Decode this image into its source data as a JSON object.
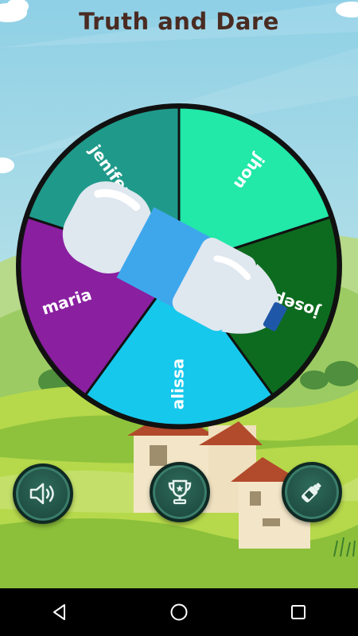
{
  "app": {
    "title": "Truth and Dare"
  },
  "wheel": {
    "players": [
      "jhon",
      "joseph",
      "alissa",
      "maria",
      "jenifer"
    ],
    "colors": [
      "#22e8a8",
      "#0d6b1f",
      "#16c8ec",
      "#8a1fa0",
      "#1f9a8a"
    ]
  },
  "buttons": {
    "sound": {
      "icon": "speaker-icon"
    },
    "leaderboard": {
      "icon": "trophy-icon"
    },
    "bottle": {
      "icon": "bottle-icon"
    }
  },
  "navbar": {
    "back": "back-icon",
    "home": "home-icon",
    "recents": "recents-icon"
  }
}
